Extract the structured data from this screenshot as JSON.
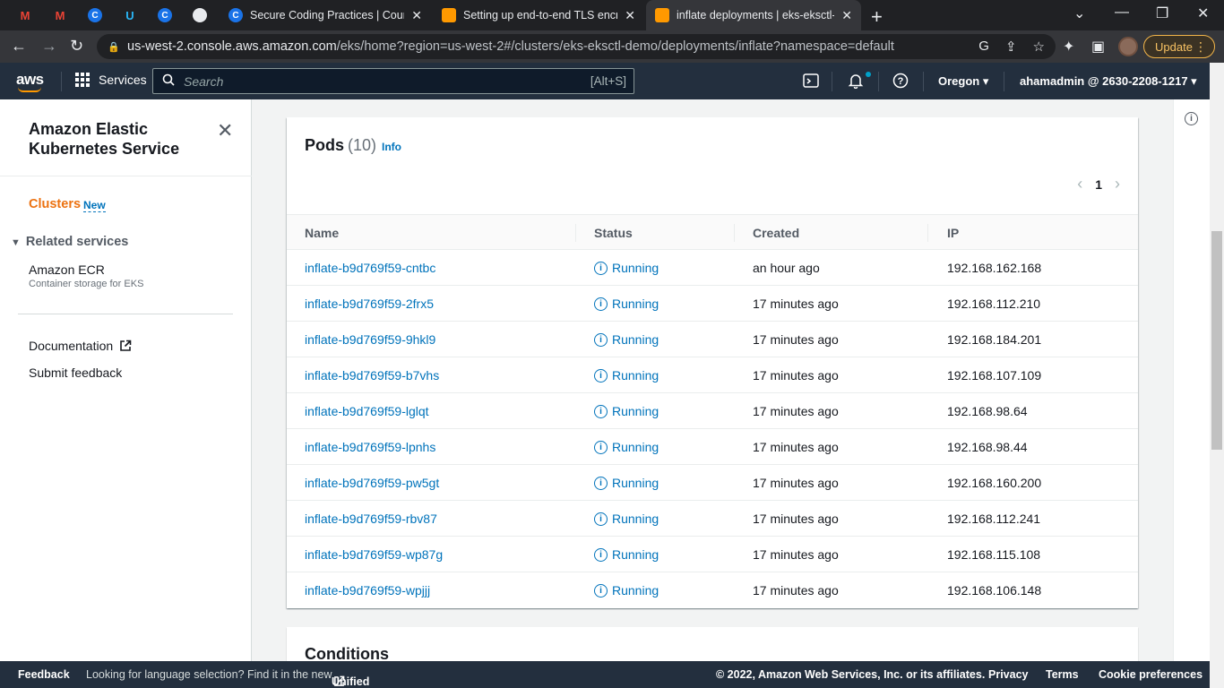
{
  "browser": {
    "tabs": [
      {
        "title": "Secure Coding Practices | Course",
        "active": false
      },
      {
        "title": "Setting up end-to-end TLS encry",
        "active": false
      },
      {
        "title": "inflate deployments | eks-eksctl-",
        "active": true
      }
    ],
    "url_host": "us-west-2.console.aws.amazon.com",
    "url_path": "/eks/home?region=us-west-2#/clusters/eks-eksctl-demo/deployments/inflate?namespace=default",
    "update_label": "Update"
  },
  "aws_nav": {
    "logo": "aws",
    "services_label": "Services",
    "search_placeholder": "Search",
    "search_shortcut": "[Alt+S]",
    "region": "Oregon",
    "account": "ahamadmin @ 2630-2208-1217"
  },
  "sidebar": {
    "title": "Amazon Elastic Kubernetes Service",
    "clusters_label": "Clusters",
    "new_badge": "New",
    "related_services_label": "Related services",
    "ecr_label": "Amazon ECR",
    "ecr_sub": "Container storage for EKS",
    "documentation_label": "Documentation",
    "submit_feedback_label": "Submit feedback"
  },
  "pods": {
    "title": "Pods",
    "count": "(10)",
    "info_label": "Info",
    "page": "1",
    "columns": [
      "Name",
      "Status",
      "Created",
      "IP"
    ],
    "rows": [
      {
        "name": "inflate-b9d769f59-cntbc",
        "status": "Running",
        "created": "an hour ago",
        "ip": "192.168.162.168"
      },
      {
        "name": "inflate-b9d769f59-2frx5",
        "status": "Running",
        "created": "17 minutes ago",
        "ip": "192.168.112.210"
      },
      {
        "name": "inflate-b9d769f59-9hkl9",
        "status": "Running",
        "created": "17 minutes ago",
        "ip": "192.168.184.201"
      },
      {
        "name": "inflate-b9d769f59-b7vhs",
        "status": "Running",
        "created": "17 minutes ago",
        "ip": "192.168.107.109"
      },
      {
        "name": "inflate-b9d769f59-lglqt",
        "status": "Running",
        "created": "17 minutes ago",
        "ip": "192.168.98.64"
      },
      {
        "name": "inflate-b9d769f59-lpnhs",
        "status": "Running",
        "created": "17 minutes ago",
        "ip": "192.168.98.44"
      },
      {
        "name": "inflate-b9d769f59-pw5gt",
        "status": "Running",
        "created": "17 minutes ago",
        "ip": "192.168.160.200"
      },
      {
        "name": "inflate-b9d769f59-rbv87",
        "status": "Running",
        "created": "17 minutes ago",
        "ip": "192.168.112.241"
      },
      {
        "name": "inflate-b9d769f59-wp87g",
        "status": "Running",
        "created": "17 minutes ago",
        "ip": "192.168.115.108"
      },
      {
        "name": "inflate-b9d769f59-wpjjj",
        "status": "Running",
        "created": "17 minutes ago",
        "ip": "192.168.106.148"
      }
    ]
  },
  "conditions": {
    "title": "Conditions"
  },
  "footer": {
    "feedback": "Feedback",
    "language_prompt": "Looking for language selection? Find it in the new",
    "unified_settings": "Unified Settings",
    "copyright": "© 2022, Amazon Web Services, Inc. or its affiliates.",
    "privacy": "Privacy",
    "terms": "Terms",
    "cookie": "Cookie preferences"
  },
  "colors": {
    "aws_nav": "#232f3e",
    "link": "#0073bb",
    "accent_orange": "#ec7211"
  }
}
